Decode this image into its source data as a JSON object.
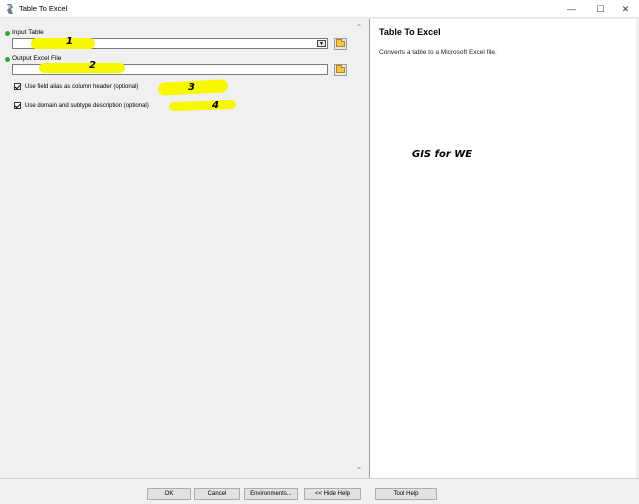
{
  "window": {
    "title": "Table To Excel",
    "minimize_glyph": "—",
    "maximize_glyph": "☐",
    "close_glyph": "✕"
  },
  "params": {
    "input_table_label": "Input Table",
    "input_table_value": "",
    "output_file_label": "Output Excel File",
    "output_file_value": "",
    "alias_checkbox_label": "Use field alias as column header (optional)",
    "alias_checked": true,
    "domain_checkbox_label": "Use domain and subtype description (optional)",
    "domain_checked": true
  },
  "annotations": {
    "n1": "1",
    "n2": "2",
    "n3": "3",
    "n4": "4",
    "highlight_color": "#f7f700"
  },
  "help": {
    "title": "Table To Excel",
    "description": "Converts a table to a Microsoft Excel file.",
    "watermark": "GIS for WE"
  },
  "buttons": {
    "ok": "OK",
    "cancel": "Cancel",
    "environments": "Environments...",
    "hide_help": "<< Hide Help",
    "tool_help": "Tool Help"
  },
  "colors": {
    "required_dot": "#2fa82f",
    "folder": "#f3c34a"
  }
}
